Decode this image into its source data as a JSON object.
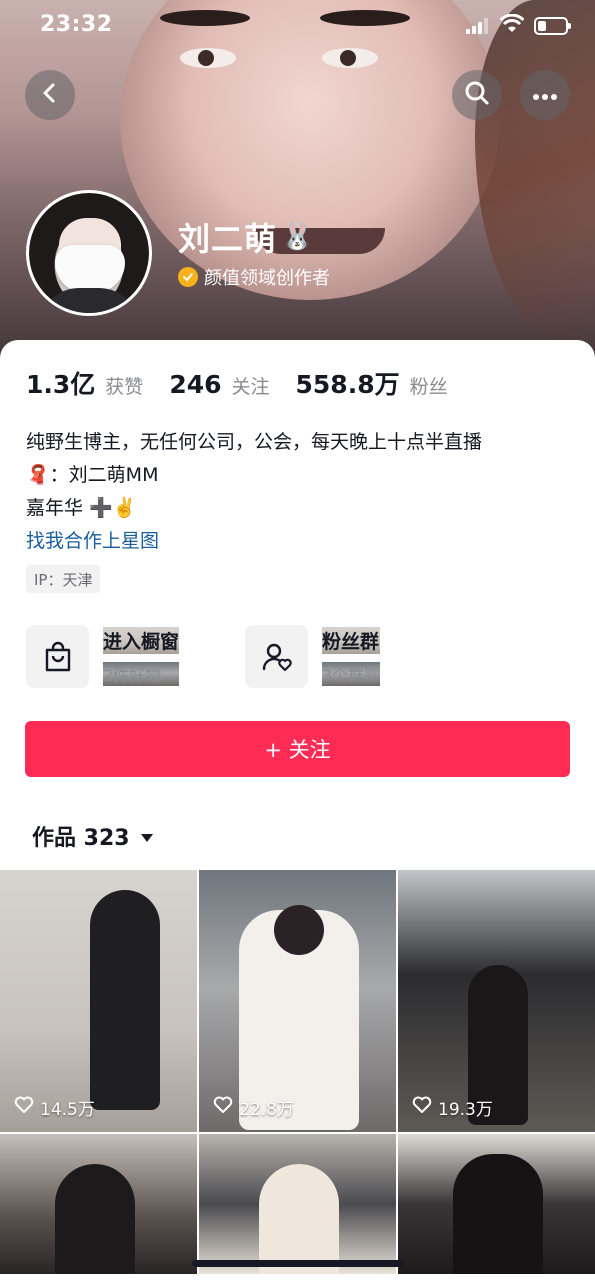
{
  "status_bar": {
    "time": "23:32"
  },
  "profile": {
    "name": "刘二萌",
    "name_emoji": "🐰",
    "verification": "颜值领域创作者"
  },
  "stats": [
    {
      "value": "1.3亿",
      "label": "获赞"
    },
    {
      "value": "246",
      "label": "关注"
    },
    {
      "value": "558.8万",
      "label": "粉丝"
    }
  ],
  "bio": {
    "line1": "纯野生博主，无任何公司，公会，每天晚上十点半直播",
    "line2_emoji": "🧣",
    "line2": "：刘二萌MM",
    "line3": "嘉年华",
    "line3_emoji": "➕✌️",
    "link": "找我合作上星图"
  },
  "ip_tag": "IP：天津",
  "shortcuts": [
    {
      "title": "进入橱窗",
      "subtitle": "2件好物",
      "icon": "shopping-bag-icon"
    },
    {
      "title": "粉丝群",
      "subtitle": "3个群聊",
      "icon": "fan-group-icon"
    }
  ],
  "follow_button": "+ 关注",
  "works_tab": {
    "label": "作品 323"
  },
  "videos": [
    {
      "likes": "14.5万"
    },
    {
      "likes": "22.8万"
    },
    {
      "likes": "19.3万"
    }
  ],
  "colors": {
    "accent": "#fe2c55",
    "link": "#1b5e9e",
    "badge": "#f6b21a"
  }
}
